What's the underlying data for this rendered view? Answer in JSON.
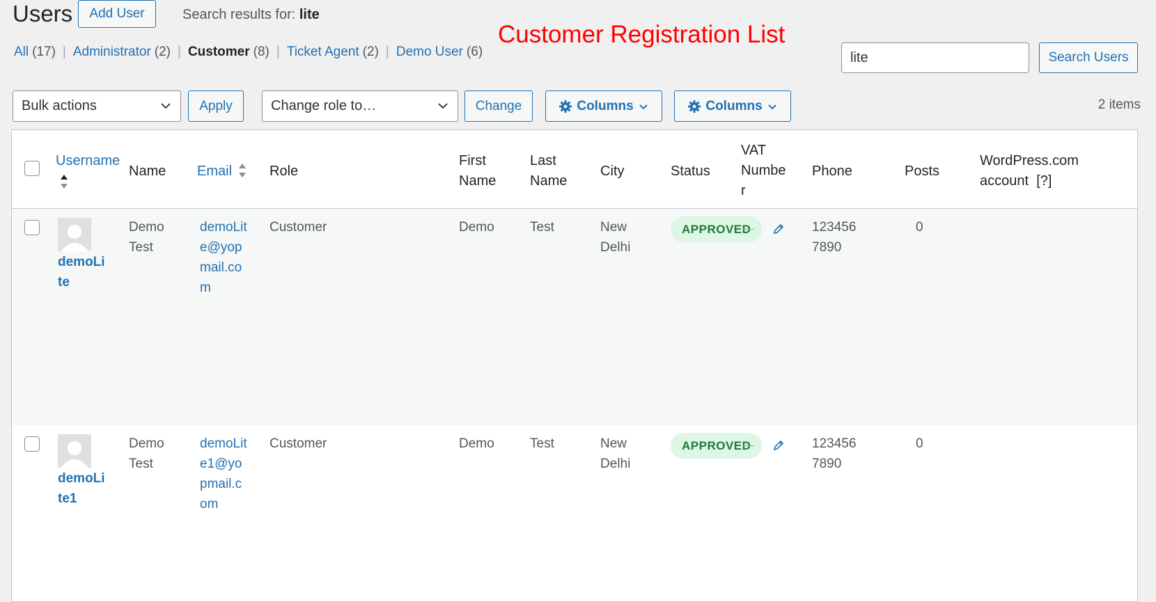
{
  "header": {
    "title": "Users",
    "add_user_label": "Add User",
    "search_results_prefix": "Search results for:",
    "search_term": "lite",
    "annotation": "Customer Registration List"
  },
  "filters": [
    {
      "label": "All",
      "count": "(17)",
      "current": false
    },
    {
      "label": "Administrator",
      "count": "(2)",
      "current": false
    },
    {
      "label": "Customer",
      "count": "(8)",
      "current": true
    },
    {
      "label": "Ticket Agent",
      "count": "(2)",
      "current": false
    },
    {
      "label": "Demo User",
      "count": "(6)",
      "current": false
    }
  ],
  "search": {
    "value": "lite",
    "button_label": "Search Users"
  },
  "toolbar": {
    "bulk_actions": "Bulk actions",
    "apply_label": "Apply",
    "change_role": "Change role to…",
    "change_label": "Change",
    "columns_label_1": "Columns",
    "columns_label_2": "Columns",
    "items_count": "2 items"
  },
  "table": {
    "headers": {
      "username": "Username",
      "name": "Name",
      "email": "Email",
      "role": "Role",
      "first_name_1": "First",
      "first_name_2": "Name",
      "last_name_1": "Last",
      "last_name_2": "Name",
      "city": "City",
      "status": "Status",
      "vat_1": "VAT",
      "vat_2": "Numbe",
      "vat_3": "r",
      "phone": "Phone",
      "posts": "Posts",
      "wpcom_1": "WordPress.com",
      "wpcom_2": "account",
      "wpcom_help": "[?]"
    },
    "rows": [
      {
        "username_lines": [
          "demoLi",
          "te"
        ],
        "name_lines": [
          "Demo",
          "Test"
        ],
        "email_lines": [
          "demoLit",
          "e@yop",
          "mail.co",
          "m"
        ],
        "role": "Customer",
        "first_name": "Demo",
        "last_name": "Test",
        "city_lines": [
          "New",
          "Delhi"
        ],
        "status": "APPROVED",
        "phone_lines": [
          "123456",
          "7890"
        ],
        "posts": "0"
      },
      {
        "username_lines": [
          "demoLi",
          "te1"
        ],
        "name_lines": [
          "Demo",
          "Test"
        ],
        "email_lines": [
          "demoLit",
          "e1@yo",
          "pmail.c",
          "om"
        ],
        "role": "Customer",
        "first_name": "Demo",
        "last_name": "Test",
        "city_lines": [
          "New",
          "Delhi"
        ],
        "status": "APPROVED",
        "phone_lines": [
          "123456",
          "7890"
        ],
        "posts": "0"
      }
    ]
  },
  "colors": {
    "link": "#2271b1",
    "annotation": "#ff0000",
    "approved_bg": "#ddf6e5",
    "approved_text": "#1e7a3a"
  },
  "icons": [
    "chevron-down-icon",
    "gear-icon",
    "sort-arrows-icon",
    "avatar-placeholder-icon",
    "pencil-icon"
  ]
}
